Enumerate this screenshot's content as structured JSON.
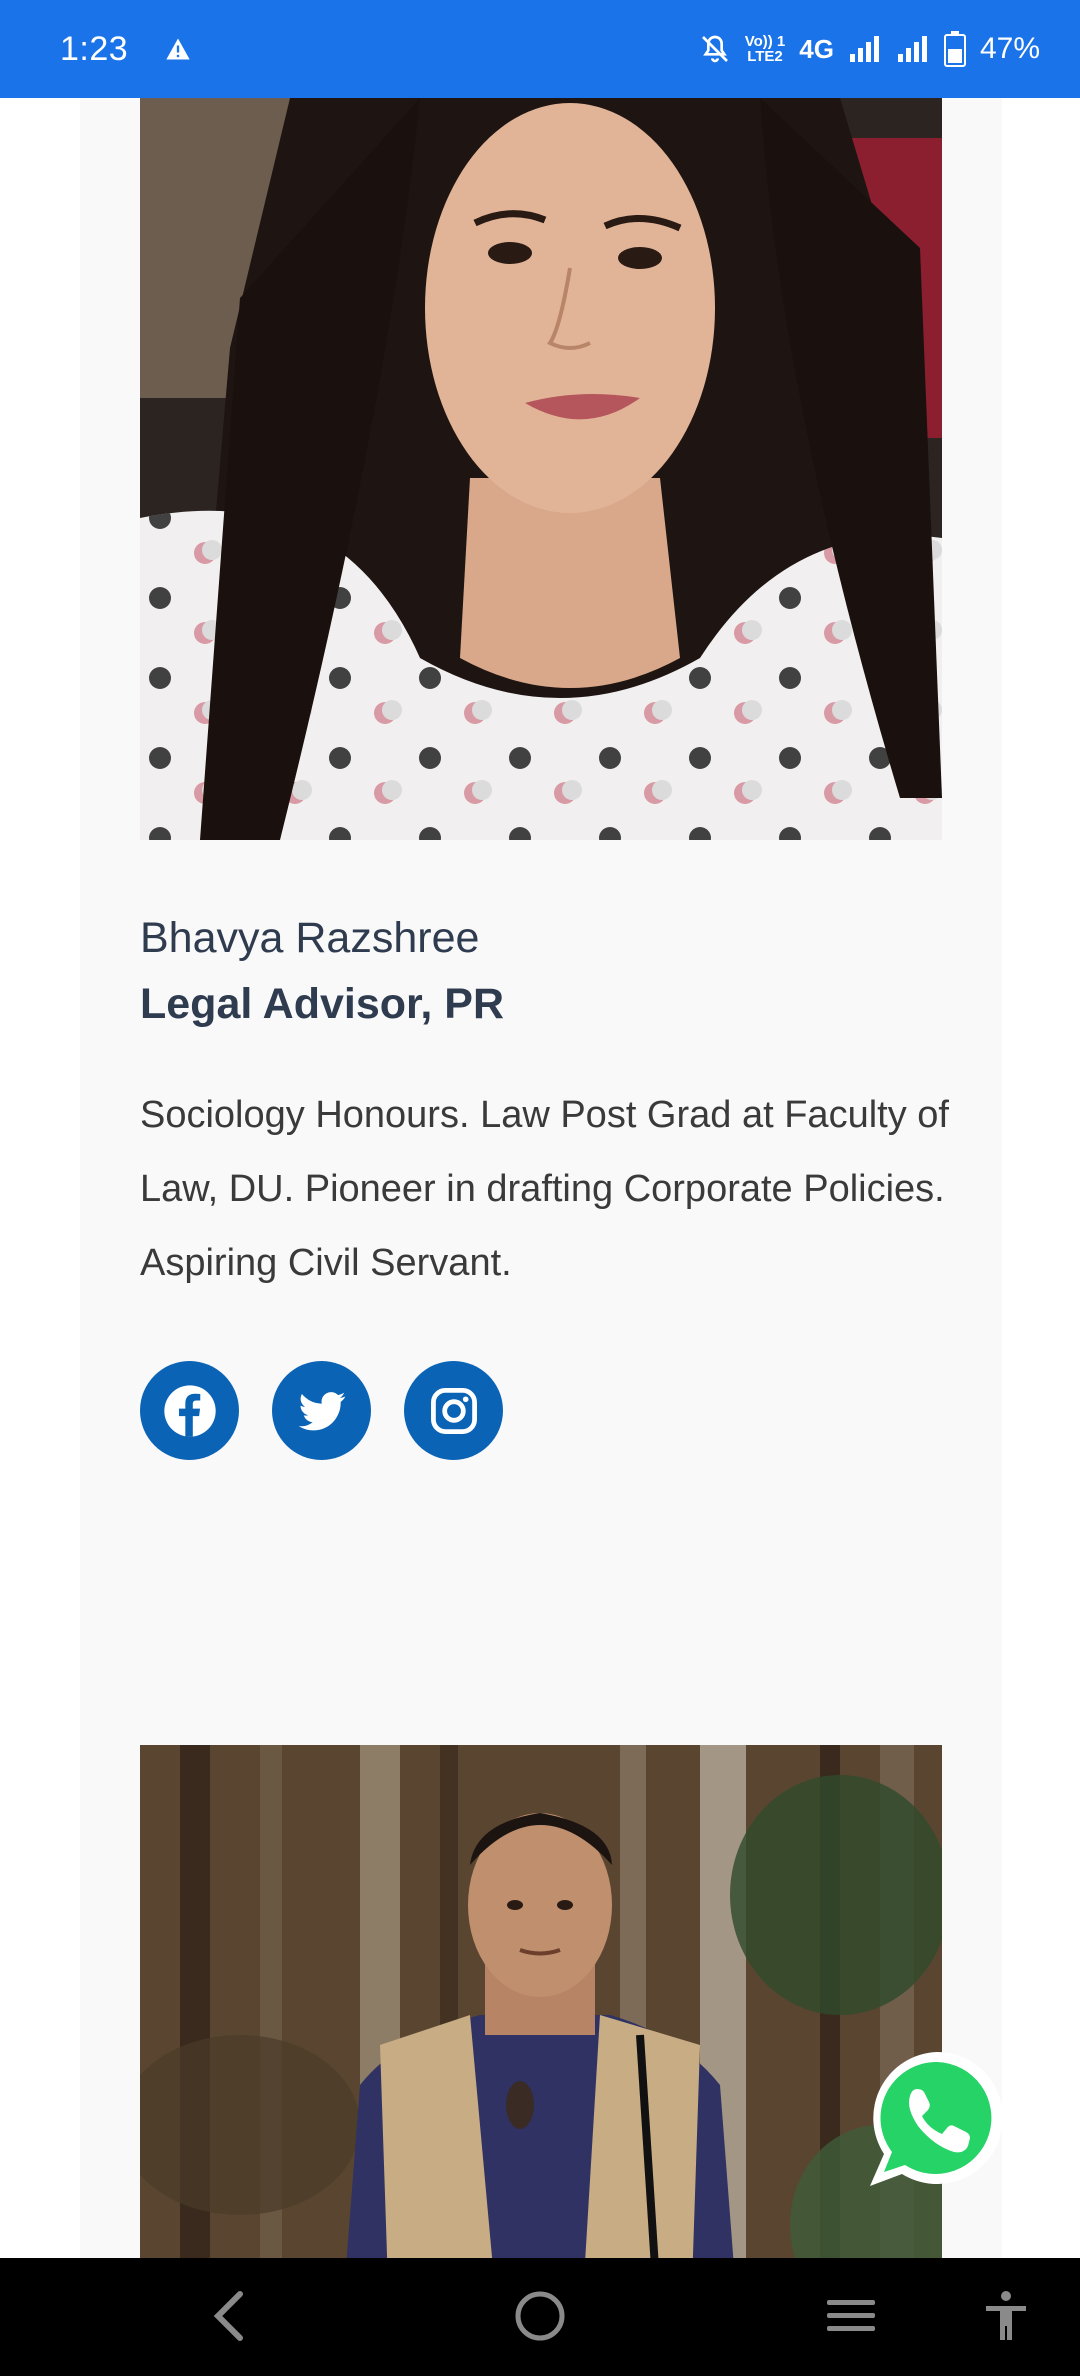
{
  "status_bar": {
    "time": "1:23",
    "battery": "47%",
    "network": "4G",
    "volte_top": "Vo)) 1",
    "volte_bottom": "LTE2",
    "background": "#1a73e8"
  },
  "members": [
    {
      "name": "Bhavya Razshree",
      "role": "Legal Advisor, PR",
      "bio": "Sociology Honours. Law Post Grad at Faculty of Law, DU. Pioneer in drafting Corporate Policies. Aspiring Civil Servant.",
      "social": [
        "facebook-icon",
        "twitter-icon",
        "instagram-icon"
      ]
    }
  ],
  "colors": {
    "card_background": "#f9f9f9",
    "social_button": "#0b63b6",
    "name_text": "#2f3b4f",
    "whatsapp": "#25d366"
  },
  "nav_bar": {
    "items": [
      "back-icon",
      "home-icon",
      "menu-icon",
      "accessibility-icon"
    ]
  }
}
